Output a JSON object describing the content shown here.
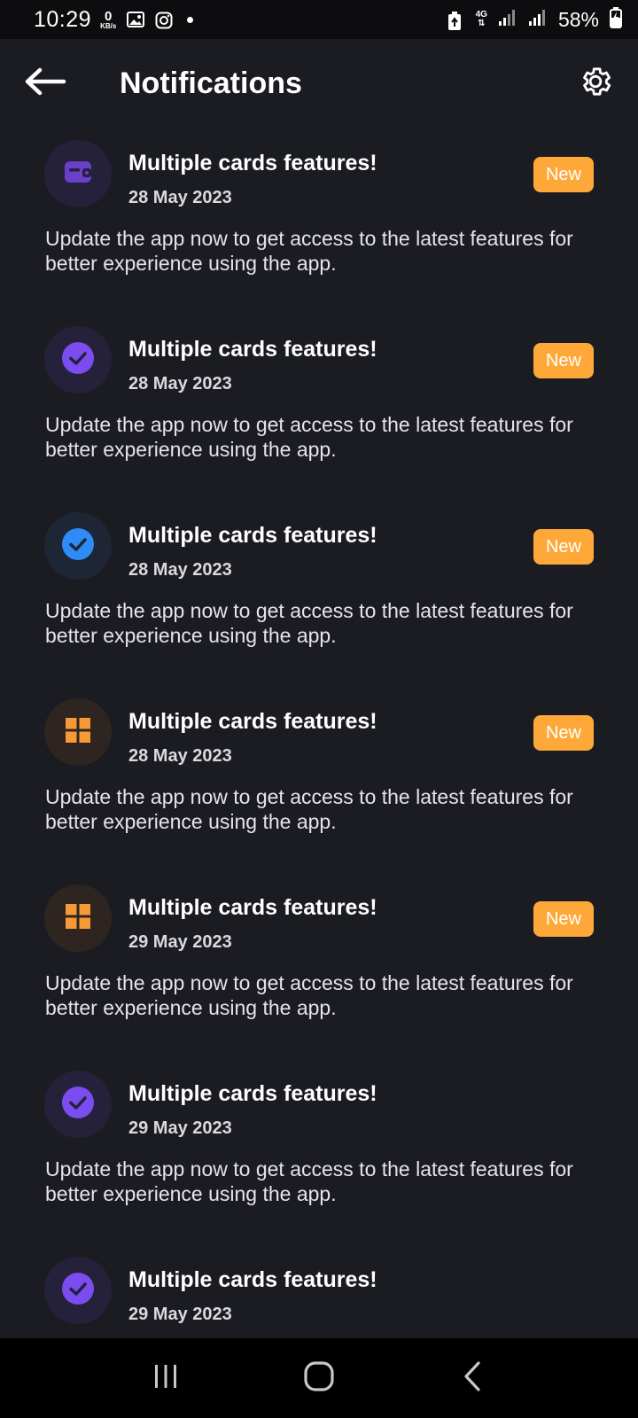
{
  "status_bar": {
    "time": "10:29",
    "net_speed_value": "0",
    "net_speed_unit": "KB/s",
    "network_type": "4G",
    "battery_percent": "58%"
  },
  "header": {
    "title": "Notifications",
    "back_icon": "arrow-left-icon",
    "settings_icon": "gear-icon"
  },
  "colors": {
    "background": "#1b1c21",
    "badge": "#ffa83a",
    "purple": "#7b4cf0",
    "blue": "#2f8bf5",
    "orange": "#f59a36"
  },
  "notifications": [
    {
      "icon": "wallet-icon",
      "title": "Multiple cards features!",
      "date": "28 May 2023",
      "badge": "New",
      "body": "Update the app now to get access to the latest features for better experience using the app."
    },
    {
      "icon": "purple-check-icon",
      "title": "Multiple cards features!",
      "date": "28 May 2023",
      "badge": "New",
      "body": "Update the app now to get access to the latest features for better experience using the app."
    },
    {
      "icon": "blue-check-icon",
      "title": "Multiple cards features!",
      "date": "28 May 2023",
      "badge": "New",
      "body": "Update the app now to get access to the latest features for better experience using the app."
    },
    {
      "icon": "grid-icon",
      "title": "Multiple cards features!",
      "date": "28 May 2023",
      "badge": "New",
      "body": "Update the app now to get access to the latest features for better experience using the app."
    },
    {
      "icon": "grid-icon",
      "title": "Multiple cards features!",
      "date": "29 May 2023",
      "badge": "New",
      "body": "Update the app now to get access to the latest features for better experience using the app."
    },
    {
      "icon": "purple-check-icon",
      "title": "Multiple cards features!",
      "date": "29 May 2023",
      "badge": "",
      "body": "Update the app now to get access to the latest features for better experience using the app."
    },
    {
      "icon": "purple-check-icon",
      "title": "Multiple cards features!",
      "date": "29 May 2023",
      "badge": "",
      "body": ""
    }
  ],
  "nav_bar": {
    "recents_icon": "recents-icon",
    "home_icon": "home-icon",
    "back_icon": "back-chevron-icon"
  }
}
